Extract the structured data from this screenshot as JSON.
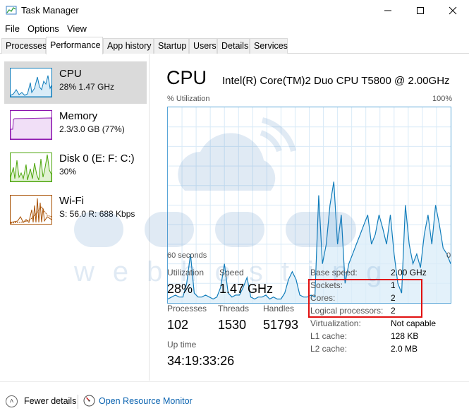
{
  "window": {
    "title": "Task Manager"
  },
  "menu": [
    "File",
    "Options",
    "View"
  ],
  "tabs": [
    "Processes",
    "Performance",
    "App history",
    "Startup",
    "Users",
    "Details",
    "Services"
  ],
  "sidebar": [
    {
      "title": "CPU",
      "sub": "28%  1.47 GHz"
    },
    {
      "title": "Memory",
      "sub": "2.3/3.0 GB (77%)"
    },
    {
      "title": "Disk 0 (E: F: C:)",
      "sub": "30%"
    },
    {
      "title": "Wi-Fi",
      "sub": "S: 56.0  R: 688 Kbps"
    }
  ],
  "main": {
    "heading": "CPU",
    "model": "Intel(R) Core(TM)2 Duo CPU T5800 @ 2.00GHz",
    "util_axis": "% Utilization",
    "max_axis": "100%",
    "time_axis": "60 seconds",
    "zero_axis": "0"
  },
  "stats": {
    "utilization_label": "Utilization",
    "utilization": "28%",
    "speed_label": "Speed",
    "speed": "1.47 GHz",
    "processes_label": "Processes",
    "processes": "102",
    "threads_label": "Threads",
    "threads": "1530",
    "handles_label": "Handles",
    "handles": "51793",
    "uptime_label": "Up time",
    "uptime": "34:19:33:26"
  },
  "specs": [
    {
      "label": "Base speed:",
      "value": "2.00 GHz"
    },
    {
      "label": "Sockets:",
      "value": "1"
    },
    {
      "label": "Cores:",
      "value": "2"
    },
    {
      "label": "Logical processors:",
      "value": "2"
    },
    {
      "label": "Virtualization:",
      "value": "Not capable"
    },
    {
      "label": "L1 cache:",
      "value": "128 KB"
    },
    {
      "label": "L2 cache:",
      "value": "2.0 MB"
    }
  ],
  "footer": {
    "fewer": "Fewer details",
    "resource": "Open Resource Monitor"
  },
  "colors": {
    "cpu": "#117dbb",
    "memory": "#8b12ae",
    "disk": "#4da60c",
    "wifi": "#a74f01",
    "highlight": "#e11010"
  },
  "cpu_history": [
    2,
    3,
    4,
    3,
    3,
    10,
    25,
    5,
    3,
    3,
    4,
    3,
    2,
    3,
    8,
    20,
    5,
    3,
    4,
    4,
    8,
    13,
    3,
    2,
    3,
    3,
    4,
    2,
    3,
    2,
    2,
    5,
    12,
    16,
    12,
    4,
    3,
    3,
    4,
    3,
    55,
    20,
    30,
    50,
    62,
    30,
    45,
    10,
    20,
    25,
    30,
    35,
    40,
    45,
    30,
    35,
    45,
    38,
    30,
    45,
    25,
    10,
    5,
    50,
    30,
    20,
    25,
    18,
    35,
    45,
    30,
    50,
    40,
    28,
    25,
    20
  ]
}
